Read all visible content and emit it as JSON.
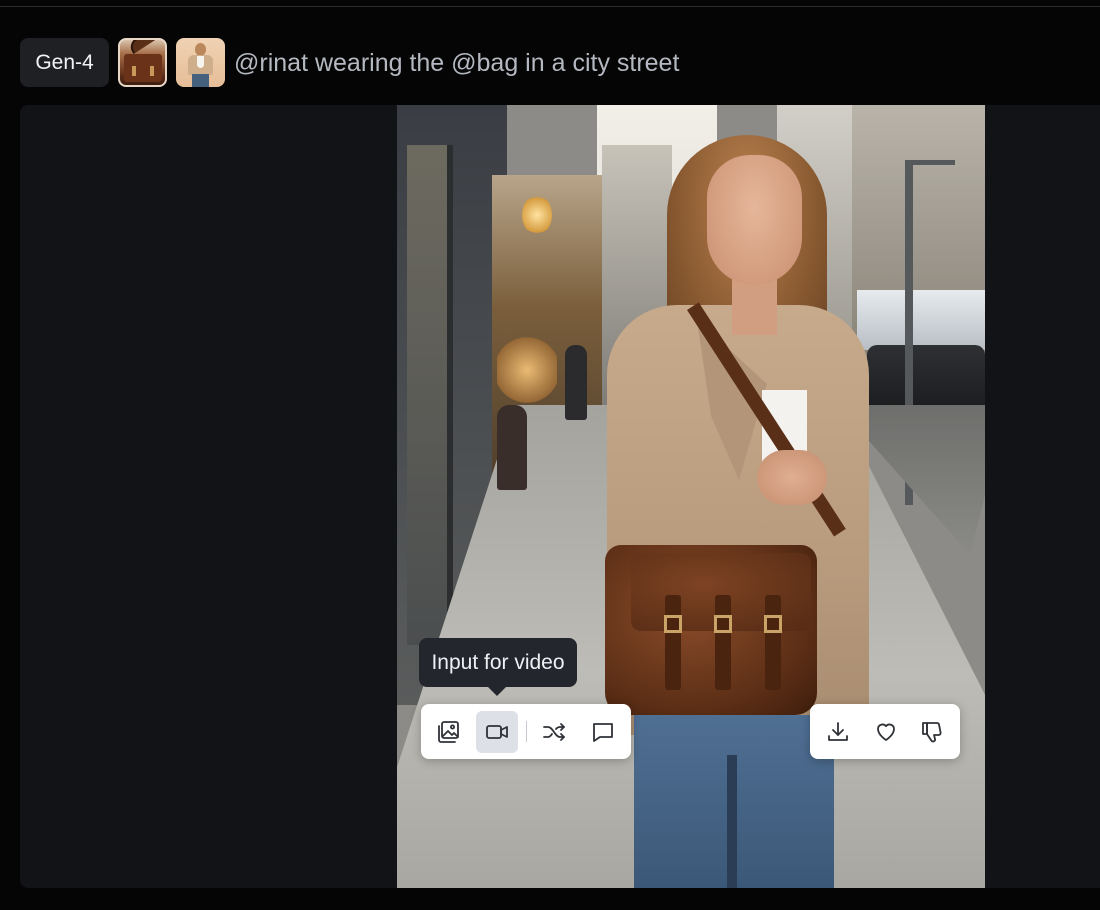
{
  "prompt_bar": {
    "model_label": "Gen-4",
    "prompt_text": "@rinat wearing the @bag in a city street",
    "reference_thumbnails": [
      "bag-reference-image",
      "person-reference-image"
    ]
  },
  "output": {
    "tooltip": "Input for video",
    "left_toolbar": {
      "icons": [
        "image-input-icon",
        "video-camera-icon",
        "shuffle-icon",
        "chat-bubble-icon"
      ],
      "active": "video-camera-icon"
    },
    "right_toolbar": {
      "icons": [
        "download-icon",
        "heart-icon",
        "thumbs-down-icon"
      ]
    }
  },
  "colors": {
    "background": "#050505",
    "canvas": "#121316",
    "chip": "#1e2024",
    "prompt_text": "#b4b8c0",
    "tooltip_bg": "#23262c",
    "toolbar_bg": "#ffffff",
    "active_button": "#dde0e6"
  }
}
